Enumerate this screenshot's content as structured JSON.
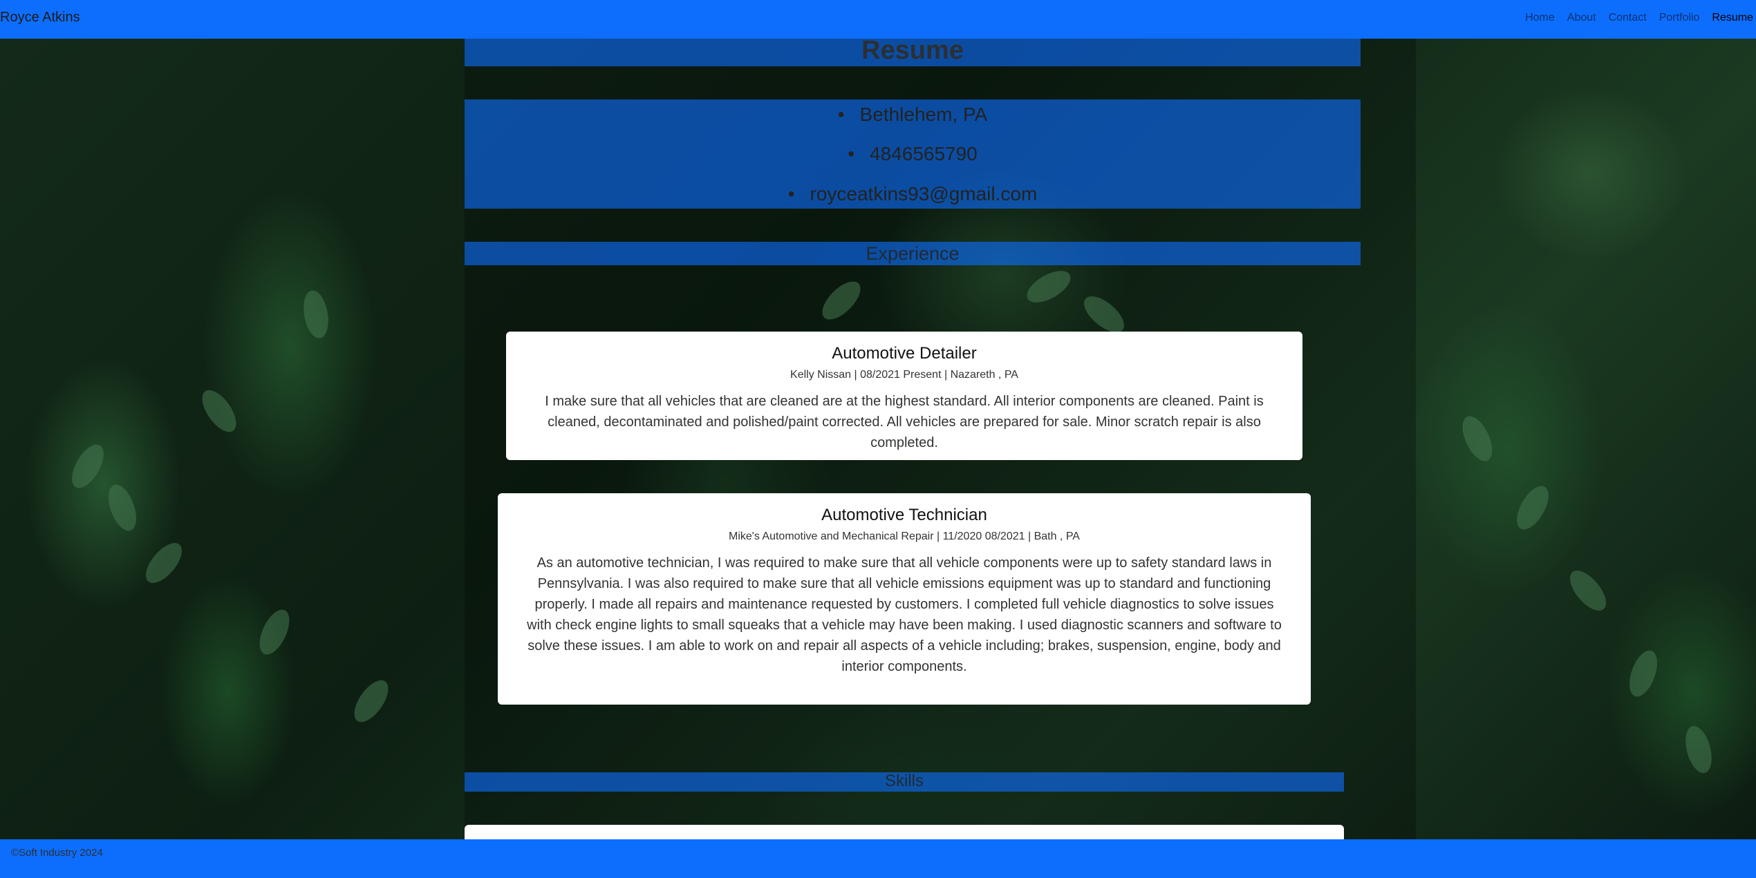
{
  "navbar": {
    "brand": "Royce Atkins",
    "links": [
      {
        "label": "Home",
        "active": false
      },
      {
        "label": "About",
        "active": false
      },
      {
        "label": "Contact",
        "active": false
      },
      {
        "label": "Portfolio",
        "active": false
      },
      {
        "label": "Resume",
        "active": true
      }
    ]
  },
  "page": {
    "title": "Resume",
    "contact": {
      "location": "Bethlehem, PA",
      "phone": "4846565790",
      "email": "royceatkins93@gmail.com"
    },
    "experience_heading": "Experience",
    "skills_heading": "Skills"
  },
  "experience": [
    {
      "title": "Automotive Detailer",
      "meta": "Kelly Nissan | 08/2021 Present | Nazareth , PA",
      "description": "I make sure that all vehicles that are cleaned are at the highest standard. All interior components are cleaned. Paint is cleaned, decontaminated and polished/paint corrected. All vehicles are prepared for sale. Minor scratch repair is also completed."
    },
    {
      "title": "Automotive Technician",
      "meta": "Mike's Automotive and Mechanical Repair | 11/2020 08/2021 | Bath , PA",
      "description": "As an automotive technician, I was required to make sure that all vehicle components were up to safety standard laws in Pennsylvania. I was also required to make sure that all vehicle emissions equipment was up to standard and functioning properly. I made all repairs and maintenance requested by customers. I completed full vehicle diagnostics to solve issues with check engine lights to small squeaks that a vehicle may have been making. I used diagnostic scanners and software to solve these issues. I am able to work on and repair all aspects of a vehicle including; brakes, suspension, engine, body and interior components."
    }
  ],
  "footer": {
    "text": "©Soft Industry 2024"
  },
  "colors": {
    "primary": "#0d6efd",
    "card": "#ffffff"
  }
}
